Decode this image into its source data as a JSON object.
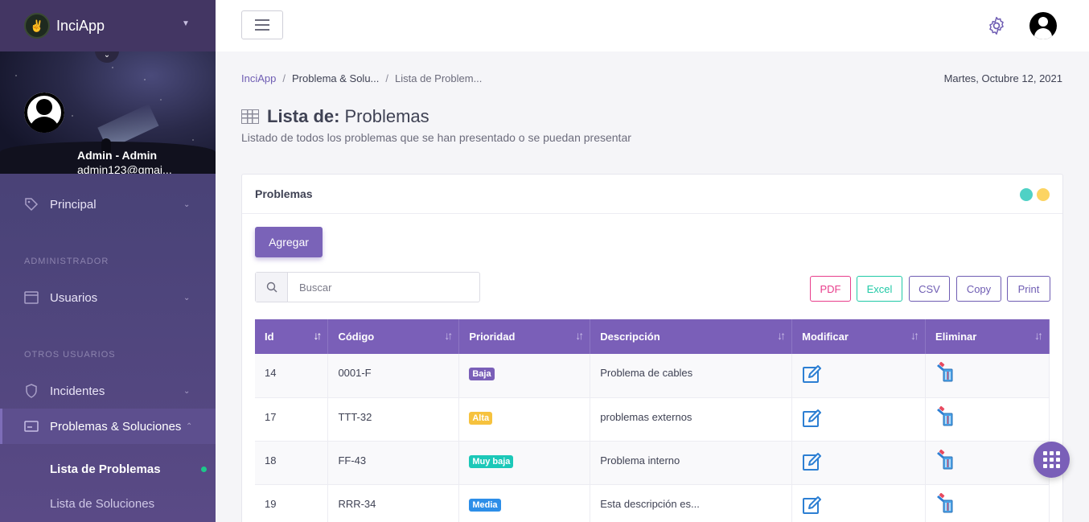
{
  "app": {
    "name": "InciApp"
  },
  "profile": {
    "name": "Admin - Admin",
    "email": "admin123@gmai..."
  },
  "nav": {
    "principal": "Principal",
    "section_admin": "ADMINISTRADOR",
    "usuarios": "Usuarios",
    "section_otros": "OTROS USUARIOS",
    "incidentes": "Incidentes",
    "problemas": "Problemas & Soluciones",
    "sub_lista_problemas": "Lista de Problemas",
    "sub_lista_soluciones": "Lista de Soluciones"
  },
  "breadcrumb": {
    "home": "InciApp",
    "sep": "/",
    "middle": "Problema & Solu...",
    "current": "Lista de Problem..."
  },
  "date": "Martes, Octubre 12, 2021",
  "page": {
    "title_bold": "Lista de:",
    "title_light": "Problemas",
    "subtitle": "Listado de todos los problemas que se han presentado o se puedan presentar"
  },
  "card": {
    "title": "Problemas",
    "add_label": "Agregar",
    "search_placeholder": "Buscar",
    "exports": [
      "PDF",
      "Excel",
      "CSV",
      "Copy",
      "Print"
    ]
  },
  "colors": {
    "accent": "#7a5fb8",
    "teal": "#4fd1c5",
    "yellow": "#fcd462"
  },
  "table": {
    "columns": [
      "Id",
      "Código",
      "Prioridad",
      "Descripción",
      "Modificar",
      "Eliminar"
    ],
    "rows": [
      {
        "id": "14",
        "codigo": "0001-F",
        "prioridad": "Baja",
        "prioridad_color": "#7a5fb8",
        "descripcion": "Problema de cables"
      },
      {
        "id": "17",
        "codigo": "TTT-32",
        "prioridad": "Alta",
        "prioridad_color": "#f6c23e",
        "descripcion": "problemas externos"
      },
      {
        "id": "18",
        "codigo": "FF-43",
        "prioridad": "Muy baja",
        "prioridad_color": "#1cc8b8",
        "descripcion": "Problema interno"
      },
      {
        "id": "19",
        "codigo": "RRR-34",
        "prioridad": "Media",
        "prioridad_color": "#2d8ee8",
        "descripcion": "Esta descripción es..."
      }
    ]
  }
}
